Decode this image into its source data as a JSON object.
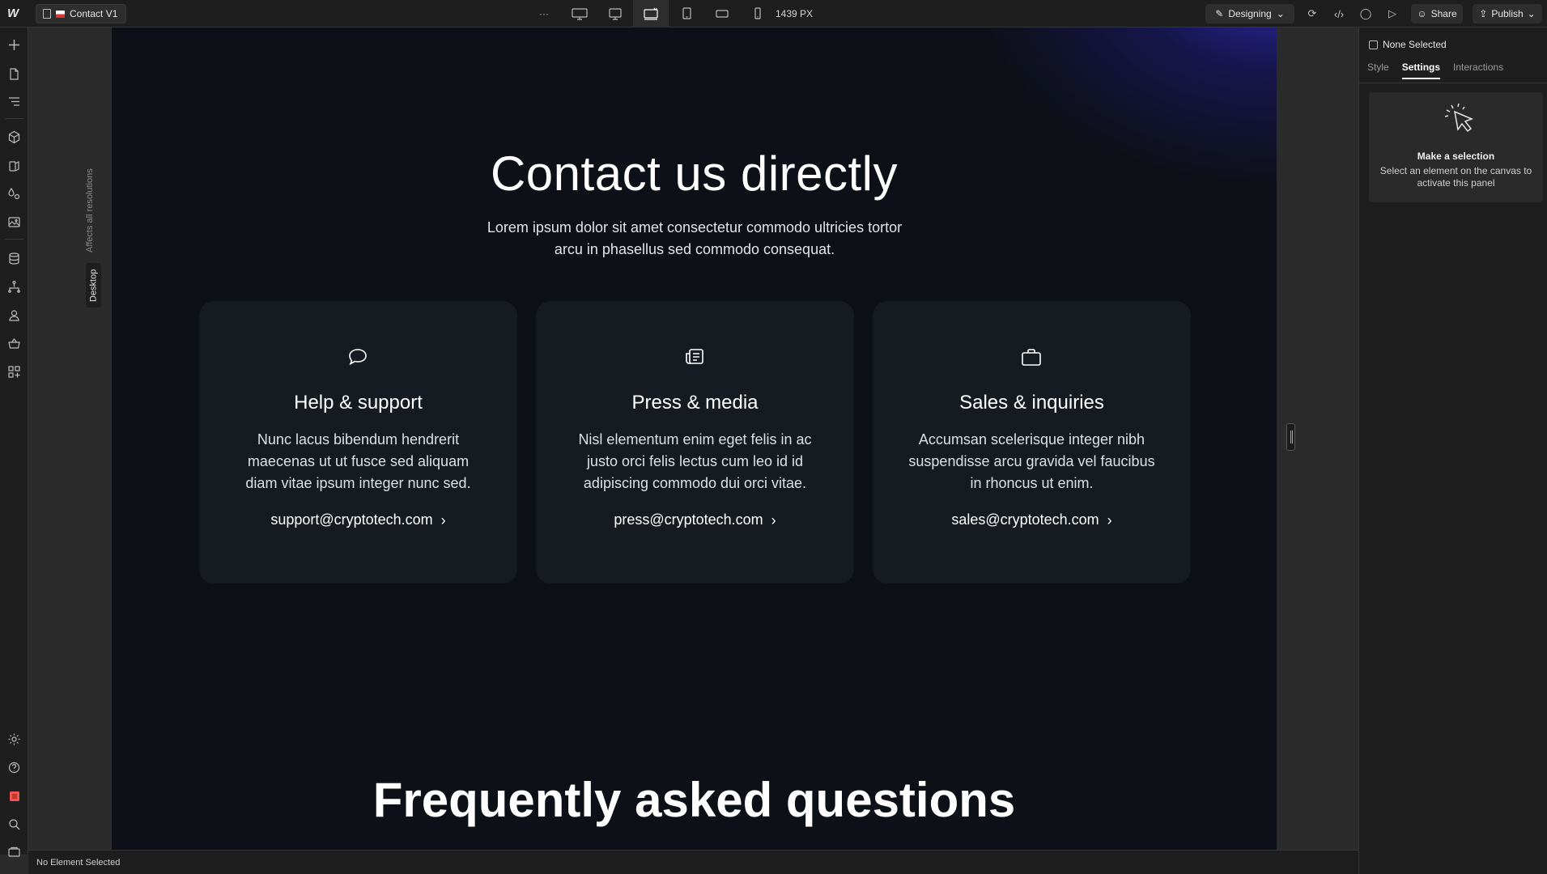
{
  "topbar": {
    "page_name": "Contact V1",
    "more": "···",
    "width_readout": "1439 PX",
    "mode_label": "Designing",
    "share_label": "Share",
    "publish_label": "Publish"
  },
  "breakpoints": [
    "desktop-large-icon",
    "desktop-icon",
    "desktop-base-icon",
    "tablet-icon",
    "mobile-landscape-icon",
    "mobile-portrait-icon"
  ],
  "canvas_labels": {
    "affects": "Affects all resolutions",
    "desktop": "Desktop"
  },
  "hero": {
    "title": "Contact us directly",
    "subtitle": "Lorem ipsum dolor sit amet consectetur commodo ultricies tortor arcu in phasellus sed commodo consequat."
  },
  "cards": [
    {
      "icon": "chat-bubble-icon",
      "title": "Help & support",
      "body": "Nunc lacus bibendum hendrerit maecenas ut ut fusce sed aliquam diam vitae ipsum integer nunc sed.",
      "email": "support@cryptotech.com"
    },
    {
      "icon": "newspaper-icon",
      "title": "Press & media",
      "body": "Nisl elementum enim eget felis in ac justo orci felis lectus cum leo id id adipiscing commodo dui orci vitae.",
      "email": "press@cryptotech.com"
    },
    {
      "icon": "briefcase-icon",
      "title": "Sales & inquiries",
      "body": "Accumsan scelerisque integer nibh suspendisse arcu gravida vel faucibus in rhoncus ut enim.",
      "email": "sales@cryptotech.com"
    }
  ],
  "faq": {
    "title": "Frequently asked questions"
  },
  "right_panel": {
    "selection": "None Selected",
    "tabs": [
      "Style",
      "Settings",
      "Interactions"
    ],
    "active_tab": "Settings",
    "empty_title": "Make a selection",
    "empty_body": "Select an element on the canvas to activate this panel"
  },
  "statusbar": {
    "text": "No Element Selected"
  },
  "colors": {
    "canvas_bg": "#0d1016",
    "card_bg": "#161a21",
    "accent_glow": "#3028aa"
  }
}
